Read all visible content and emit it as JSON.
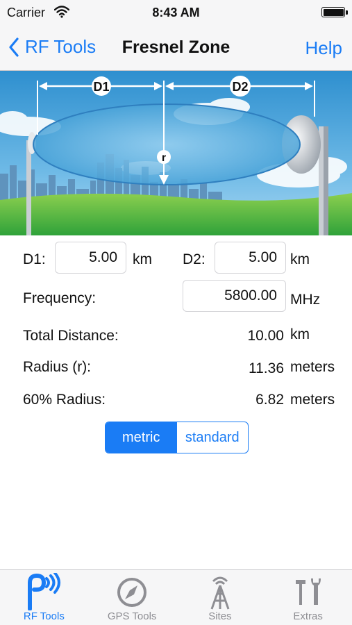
{
  "status": {
    "carrier": "Carrier",
    "time": "8:43 AM"
  },
  "nav": {
    "back_label": "RF Tools",
    "title": "Fresnel Zone",
    "help_label": "Help"
  },
  "diagram": {
    "d1_label": "D1",
    "d2_label": "D2",
    "r_label": "r"
  },
  "form": {
    "d1": {
      "label": "D1:",
      "value": "5.00",
      "unit": "km"
    },
    "d2": {
      "label": "D2:",
      "value": "5.00",
      "unit": "km"
    },
    "frequency": {
      "label": "Frequency:",
      "value": "5800.00",
      "unit": "MHz"
    },
    "total_distance": {
      "label": "Total Distance:",
      "value": "10.00",
      "unit": "km"
    },
    "radius": {
      "label": "Radius (r):",
      "value": "11.36",
      "unit": "meters"
    },
    "radius60": {
      "label": "60% Radius:",
      "value": "6.82",
      "unit": "meters"
    }
  },
  "units_toggle": {
    "options": [
      "metric",
      "standard"
    ],
    "selected": "metric"
  },
  "tabs": [
    {
      "label": "RF Tools",
      "icon": "rf-signal-icon",
      "active": true
    },
    {
      "label": "GPS Tools",
      "icon": "compass-icon",
      "active": false
    },
    {
      "label": "Sites",
      "icon": "tower-icon",
      "active": false
    },
    {
      "label": "Extras",
      "icon": "tools-icon",
      "active": false
    }
  ],
  "colors": {
    "accent": "#1a7cf5",
    "bar_bg": "#f6f6f7",
    "grass": "#3fae3a",
    "sky": "#3e9fd6"
  }
}
